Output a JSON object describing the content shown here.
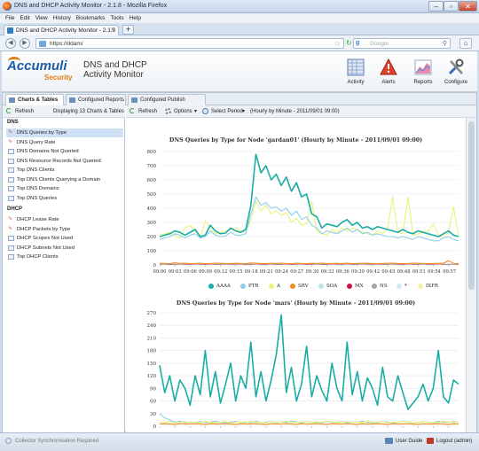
{
  "window": {
    "title": "DNS and DHCP Activity Monitor - 2.1.8 - Mozilla Firefox",
    "tab_label": "DNS and DHCP Activity Monitor - 2.1.8",
    "url": "https://ddam/",
    "search_placeholder": "Google",
    "search_engine_glyph": "g"
  },
  "menu": [
    "File",
    "Edit",
    "View",
    "History",
    "Bookmarks",
    "Tools",
    "Help"
  ],
  "app": {
    "logo_main": "Accumuli",
    "logo_sub": "Security",
    "title_line1": "DNS and DHCP",
    "title_line2": "Activity Monitor",
    "top_icons": [
      {
        "label": "Activity",
        "icon": "activity-grid-icon"
      },
      {
        "label": "Alerts",
        "icon": "alert-triangle-icon"
      },
      {
        "label": "Reports",
        "icon": "reports-chart-icon"
      },
      {
        "label": "Configure",
        "icon": "configure-tools-icon"
      }
    ]
  },
  "main_tabs": [
    "Charts & Tables",
    "Configured Reports",
    "Configured Publish Methods"
  ],
  "left": {
    "refresh_label": "Refresh",
    "count_label": "Displaying 13 Charts & Tables",
    "sections": [
      {
        "title": "DNS",
        "items": [
          {
            "label": "DNS Queries by Type",
            "kind": "chart",
            "selected": true
          },
          {
            "label": "DNS Query Rate",
            "kind": "chart"
          },
          {
            "label": "DNS Domains Not Queried",
            "kind": "table"
          },
          {
            "label": "DNS Resource Records Not Queried",
            "kind": "table"
          },
          {
            "label": "Top DNS Clients",
            "kind": "table"
          },
          {
            "label": "Top DNS Clients Querying a Domain",
            "kind": "table"
          },
          {
            "label": "Top DNS Domains",
            "kind": "table"
          },
          {
            "label": "Top DNS Queries",
            "kind": "table"
          }
        ]
      },
      {
        "title": "DHCP",
        "items": [
          {
            "label": "DHCP Lease Rate",
            "kind": "chart"
          },
          {
            "label": "DHCP Packets by Type",
            "kind": "chart"
          },
          {
            "label": "DHCP Scopes Not Used",
            "kind": "table"
          },
          {
            "label": "DHCP Subnets Not Used",
            "kind": "table"
          },
          {
            "label": "Top DHCP Clients",
            "kind": "table"
          }
        ]
      }
    ]
  },
  "right_toolbar": {
    "refresh_label": "Refresh",
    "options_label": "Options",
    "period_label": "Select Period",
    "period_value": "(Hourly by Minute - 2011/09/01 09:00)"
  },
  "status": {
    "sync": "Collector Synchronisation Required",
    "guide": "User Guide",
    "logout": "Logout (admin)"
  },
  "colors": {
    "AAAA": "#1aada3",
    "PTR": "#8fcfe8",
    "A": "#eaf27a",
    "SRV": "#f08b1e",
    "SOA": "#bfe3ea",
    "MX": "#c8143c",
    "NS": "#a0a6ad",
    "*": "#d0ecf3",
    "IXFR": "#f3f3a6"
  },
  "chart_data": [
    {
      "type": "line",
      "title": "DNS Queries by Type for Node 'gardan01' (Hourly by Minute - 2011/09/01 09:00)",
      "ylim": [
        0,
        800
      ],
      "yticks": [
        0,
        100,
        200,
        300,
        400,
        500,
        600,
        700,
        800
      ],
      "xticks": [
        "09:00",
        "09:03",
        "09:06",
        "09:09",
        "09:12",
        "09:15",
        "09:18",
        "09:21",
        "09:24",
        "09:27",
        "09:30",
        "09:33",
        "09:36",
        "09:39",
        "09:42",
        "09:45",
        "09:48",
        "09:51",
        "09:54",
        "09:57"
      ],
      "series": [
        {
          "name": "AAAA",
          "values": [
            200,
            210,
            220,
            240,
            230,
            210,
            230,
            250,
            200,
            210,
            280,
            240,
            220,
            225,
            260,
            240,
            230,
            250,
            420,
            780,
            650,
            700,
            600,
            640,
            560,
            620,
            520,
            580,
            480,
            500,
            360,
            340,
            260,
            290,
            280,
            270,
            300,
            320,
            280,
            300,
            260,
            270,
            250,
            270,
            260,
            250,
            240,
            230,
            250,
            230,
            220,
            240,
            230,
            220,
            210,
            200,
            220,
            240,
            210,
            200
          ]
        },
        {
          "name": "PTR",
          "values": [
            180,
            190,
            200,
            220,
            210,
            190,
            210,
            220,
            190,
            200,
            240,
            210,
            200,
            205,
            230,
            210,
            210,
            220,
            360,
            480,
            420,
            440,
            400,
            410,
            380,
            400,
            350,
            380,
            320,
            340,
            280,
            260,
            220,
            240,
            230,
            220,
            240,
            260,
            230,
            250,
            220,
            230,
            210,
            220,
            210,
            200,
            200,
            190,
            200,
            190,
            180,
            200,
            190,
            180,
            170,
            170,
            190,
            200,
            180,
            170
          ]
        },
        {
          "name": "A",
          "values": [
            210,
            220,
            230,
            210,
            190,
            260,
            280,
            240,
            200,
            310,
            260,
            220,
            230,
            240,
            250,
            260,
            240,
            230,
            320,
            450,
            380,
            420,
            360,
            380,
            350,
            370,
            300,
            330,
            280,
            290,
            450,
            240,
            220,
            210,
            250,
            230,
            260,
            240,
            260,
            250,
            230,
            220,
            210,
            240,
            220,
            260,
            480,
            230,
            220,
            480,
            210,
            220,
            230,
            240,
            290,
            210,
            200,
            230,
            410,
            200
          ]
        },
        {
          "name": "SRV",
          "values": [
            12,
            10,
            8,
            15,
            10,
            12,
            9,
            10,
            12,
            8,
            10,
            12,
            11,
            9,
            10,
            12,
            10,
            8,
            14,
            12,
            10,
            9,
            11,
            10,
            12,
            10,
            8,
            12,
            10,
            9,
            11,
            10,
            12,
            9,
            10,
            11,
            10,
            12,
            9,
            10,
            11,
            12,
            10,
            9,
            10,
            11,
            12,
            10,
            9,
            10,
            12,
            11,
            10,
            9,
            10,
            11,
            12,
            30,
            10,
            9
          ]
        },
        {
          "name": "SOA",
          "values": [
            6,
            5,
            6,
            7,
            5,
            6,
            6,
            5,
            6,
            7,
            5,
            6,
            6,
            5,
            6,
            7,
            5,
            6,
            6,
            5,
            6,
            7,
            5,
            6,
            6,
            5,
            6,
            7,
            5,
            6,
            6,
            5,
            6,
            7,
            5,
            6,
            6,
            5,
            6,
            7,
            5,
            6,
            6,
            5,
            6,
            7,
            5,
            6,
            6,
            5,
            6,
            7,
            5,
            6,
            6,
            5,
            6,
            7,
            5,
            6
          ]
        },
        {
          "name": "MX",
          "values": [
            4,
            5,
            4,
            3,
            5,
            4,
            4,
            5,
            4,
            3,
            5,
            4,
            4,
            5,
            4,
            3,
            5,
            4,
            4,
            5,
            4,
            3,
            5,
            4,
            4,
            5,
            4,
            3,
            5,
            4,
            4,
            5,
            4,
            3,
            5,
            4,
            4,
            5,
            4,
            3,
            5,
            4,
            4,
            5,
            4,
            3,
            5,
            4,
            4,
            5,
            4,
            3,
            5,
            4,
            4,
            5,
            4,
            3,
            5,
            4
          ]
        },
        {
          "name": "NS",
          "values": [
            3,
            3,
            4,
            3,
            3,
            3,
            4,
            3,
            3,
            3,
            4,
            3,
            3,
            3,
            4,
            3,
            3,
            3,
            4,
            3,
            3,
            3,
            4,
            3,
            3,
            3,
            4,
            3,
            3,
            3,
            4,
            3,
            3,
            3,
            4,
            3,
            3,
            3,
            4,
            3,
            3,
            3,
            4,
            3,
            3,
            3,
            4,
            3,
            3,
            3,
            4,
            3,
            3,
            3,
            4,
            3,
            3,
            3,
            4,
            3
          ]
        },
        {
          "name": "*",
          "values": [
            2,
            2,
            2,
            2,
            2,
            2,
            2,
            2,
            2,
            2,
            2,
            2,
            2,
            2,
            2,
            2,
            2,
            2,
            2,
            2,
            2,
            2,
            2,
            2,
            2,
            2,
            2,
            2,
            2,
            2,
            2,
            2,
            2,
            2,
            2,
            2,
            2,
            2,
            2,
            2,
            2,
            2,
            2,
            2,
            2,
            2,
            2,
            2,
            2,
            2,
            2,
            2,
            2,
            2,
            2,
            2,
            2,
            2,
            2,
            2
          ]
        },
        {
          "name": "IXFR",
          "values": [
            1,
            1,
            1,
            1,
            1,
            1,
            1,
            1,
            1,
            1,
            1,
            1,
            1,
            1,
            1,
            1,
            1,
            1,
            1,
            1,
            1,
            1,
            1,
            1,
            1,
            1,
            1,
            1,
            1,
            1,
            1,
            1,
            1,
            1,
            1,
            1,
            1,
            1,
            1,
            1,
            1,
            1,
            1,
            1,
            1,
            1,
            1,
            1,
            1,
            1,
            1,
            1,
            1,
            1,
            1,
            1,
            1,
            1,
            1,
            1
          ]
        }
      ]
    },
    {
      "type": "line",
      "title": "DNS Queries by Type for Node 'mars' (Hourly by Minute - 2011/09/01 09:00)",
      "ylim": [
        0,
        270
      ],
      "yticks": [
        0,
        30,
        60,
        90,
        120,
        150,
        180,
        210,
        240,
        270
      ],
      "series": [
        {
          "name": "AAAA",
          "values": [
            145,
            80,
            120,
            60,
            110,
            90,
            50,
            120,
            75,
            180,
            70,
            130,
            55,
            100,
            150,
            60,
            120,
            90,
            200,
            70,
            130,
            60,
            110,
            170,
            265,
            80,
            140,
            60,
            100,
            190,
            70,
            120,
            85,
            60,
            150,
            90,
            60,
            200,
            75,
            130,
            60,
            115,
            90,
            50,
            140,
            70,
            60,
            120,
            80,
            40,
            55,
            70,
            100,
            60,
            90,
            180,
            70,
            55,
            110,
            100
          ]
        },
        {
          "name": "A",
          "values": [
            10,
            8,
            12,
            6,
            9,
            11,
            8,
            10,
            7,
            12,
            9,
            8,
            10,
            11,
            7,
            9,
            10,
            8,
            12,
            9,
            10,
            8,
            11,
            9,
            10,
            12,
            8,
            9,
            10,
            11,
            9,
            8,
            10,
            12,
            9,
            8,
            10,
            11,
            9,
            10,
            8,
            12,
            10,
            9,
            11,
            8,
            10,
            9,
            12,
            10,
            8,
            9,
            11,
            10,
            9,
            8,
            12,
            10,
            9,
            10
          ]
        },
        {
          "name": "PTR",
          "values": [
            30,
            20,
            15,
            10,
            12,
            8,
            10,
            9,
            11,
            8,
            10,
            12,
            9,
            8,
            10,
            11,
            9,
            10,
            8,
            12,
            9,
            10,
            11,
            8,
            10,
            9,
            12,
            10,
            8,
            11,
            9,
            10,
            8,
            12,
            10,
            9,
            11,
            8,
            10,
            9,
            12,
            10,
            8,
            9,
            11,
            10,
            8,
            9,
            12,
            10,
            8,
            9,
            11,
            10,
            8,
            12,
            9,
            10,
            11,
            9
          ]
        },
        {
          "name": "SRV",
          "values": [
            5,
            6,
            5,
            4,
            6,
            5,
            5,
            6,
            5,
            4,
            6,
            5,
            5,
            6,
            5,
            4,
            6,
            5,
            5,
            6,
            5,
            4,
            6,
            5,
            5,
            6,
            5,
            4,
            6,
            5,
            5,
            6,
            5,
            4,
            6,
            5,
            5,
            6,
            5,
            4,
            6,
            5,
            5,
            6,
            5,
            4,
            6,
            5,
            5,
            6,
            5,
            4,
            6,
            5,
            5,
            6,
            5,
            4,
            6,
            5
          ]
        }
      ]
    }
  ]
}
